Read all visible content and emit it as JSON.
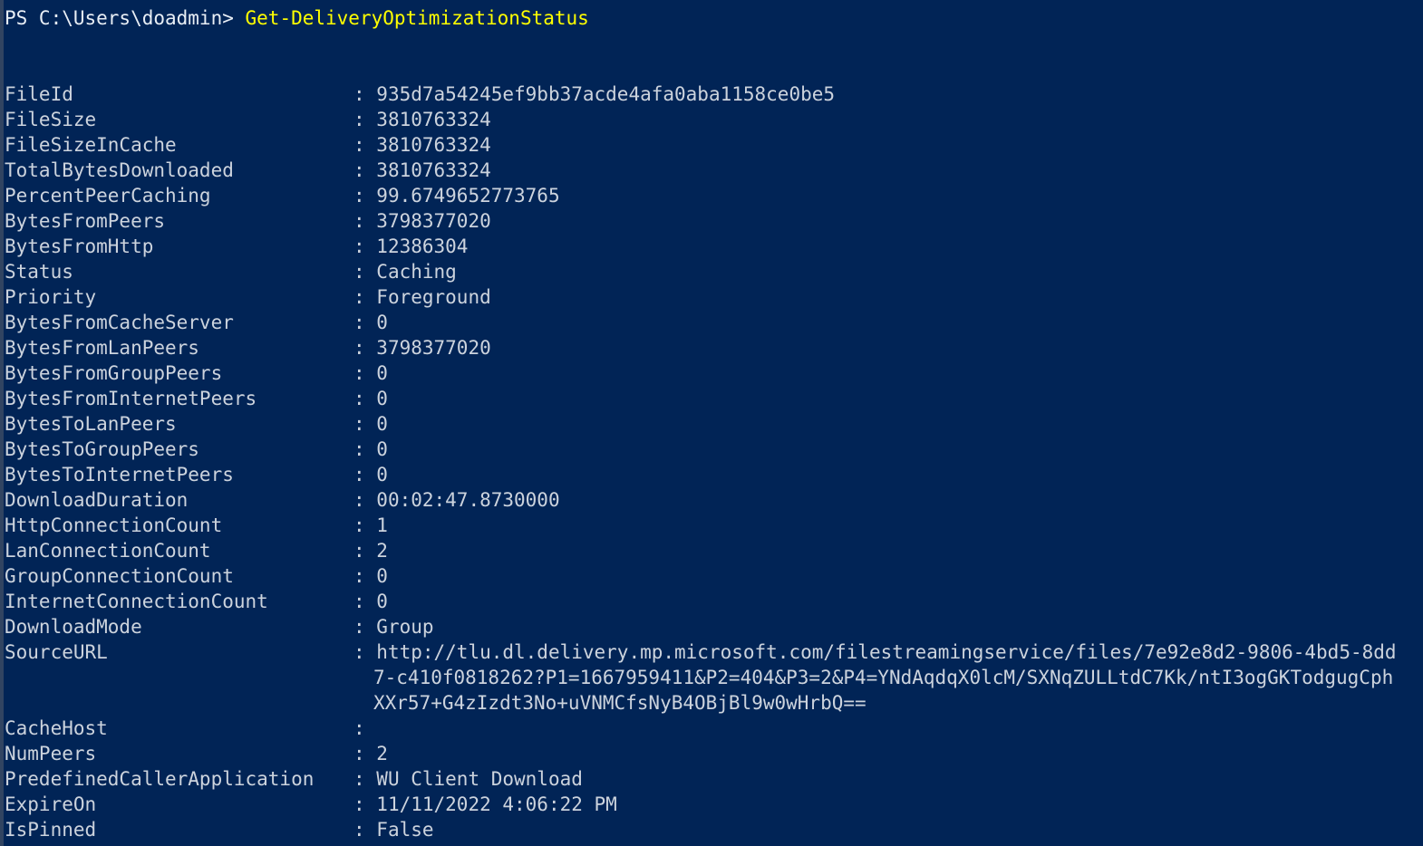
{
  "terminal": {
    "background_color": "#012456",
    "text_color": "#ccd3dd",
    "command_color": "#ffff00",
    "prompt": "PS C:\\Users\\doadmin> ",
    "command": "Get-DeliveryOptimizationStatus",
    "blank": " "
  },
  "output": {
    "separator": ": ",
    "properties": [
      {
        "name": "FileId",
        "value": "935d7a54245ef9bb37acde4afa0aba1158ce0be5"
      },
      {
        "name": "FileSize",
        "value": "3810763324"
      },
      {
        "name": "FileSizeInCache",
        "value": "3810763324"
      },
      {
        "name": "TotalBytesDownloaded",
        "value": "3810763324"
      },
      {
        "name": "PercentPeerCaching",
        "value": "99.6749652773765"
      },
      {
        "name": "BytesFromPeers",
        "value": "3798377020"
      },
      {
        "name": "BytesFromHttp",
        "value": "12386304"
      },
      {
        "name": "Status",
        "value": "Caching"
      },
      {
        "name": "Priority",
        "value": "Foreground"
      },
      {
        "name": "BytesFromCacheServer",
        "value": "0"
      },
      {
        "name": "BytesFromLanPeers",
        "value": "3798377020"
      },
      {
        "name": "BytesFromGroupPeers",
        "value": "0"
      },
      {
        "name": "BytesFromInternetPeers",
        "value": "0"
      },
      {
        "name": "BytesToLanPeers",
        "value": "0"
      },
      {
        "name": "BytesToGroupPeers",
        "value": "0"
      },
      {
        "name": "BytesToInternetPeers",
        "value": "0"
      },
      {
        "name": "DownloadDuration",
        "value": "00:02:47.8730000"
      },
      {
        "name": "HttpConnectionCount",
        "value": "1"
      },
      {
        "name": "LanConnectionCount",
        "value": "2"
      },
      {
        "name": "GroupConnectionCount",
        "value": "0"
      },
      {
        "name": "InternetConnectionCount",
        "value": "0"
      },
      {
        "name": "DownloadMode",
        "value": "Group"
      }
    ],
    "source_url": {
      "name": "SourceURL",
      "line1": "http://tlu.dl.delivery.mp.microsoft.com/filestreamingservice/files/7e92e8d2-9806-4bd5-8dd",
      "line2": "7-c410f0818262?P1=1667959411&P2=404&P3=2&P4=YNdAqdqX0lcM/SXNqZULLtdC7Kk/ntI3ogGKTodgugCph",
      "line3": "XXr57+G4zIzdt3No+uVNMCfsNyB4OBjBl9w0wHrbQ=="
    },
    "properties_tail": [
      {
        "name": "CacheHost",
        "value": ""
      },
      {
        "name": "NumPeers",
        "value": "2"
      },
      {
        "name": "PredefinedCallerApplication",
        "value": "WU Client Download"
      },
      {
        "name": "ExpireOn",
        "value": "11/11/2022 4:06:22 PM"
      },
      {
        "name": "IsPinned",
        "value": "False"
      }
    ]
  }
}
